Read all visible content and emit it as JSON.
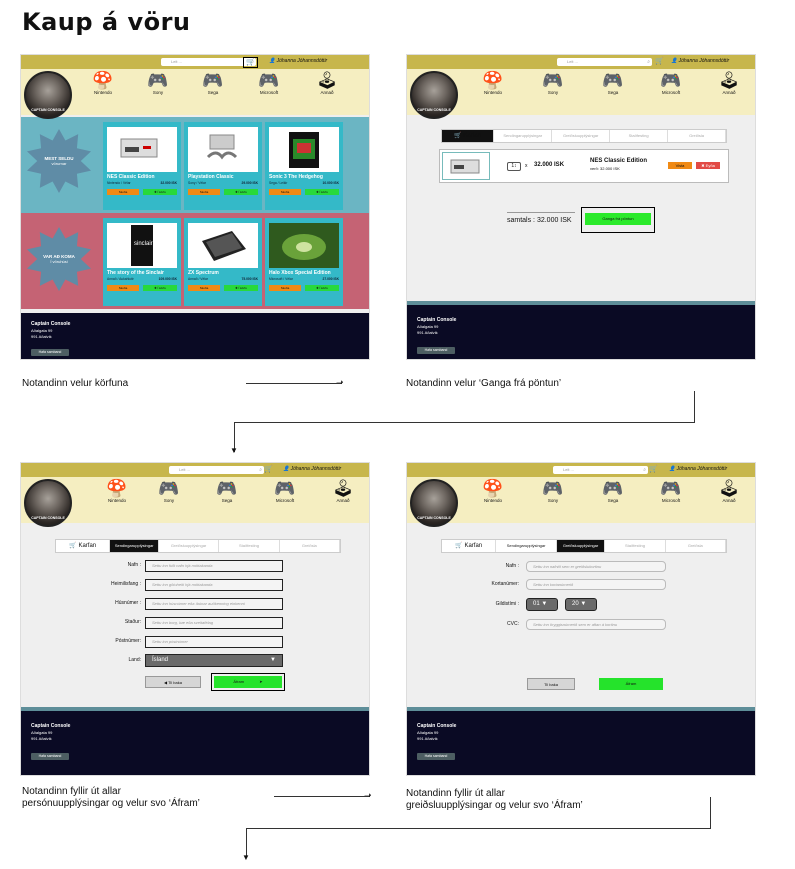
{
  "title": "Kaup á vöru",
  "common": {
    "search_placeholder": "Leit ...",
    "user_name": "Jóhanna Jóhannsdóttir",
    "logo_text": "CAPTAIN CONSOLE",
    "categories": [
      {
        "label": "Nintendo",
        "icon": "nintendo-icon"
      },
      {
        "label": "Sony",
        "icon": "gamepad-icon"
      },
      {
        "label": "Sega",
        "icon": "sega-pad-icon"
      },
      {
        "label": "Microsoft",
        "icon": "xbox-pad-icon"
      },
      {
        "label": "Annað",
        "icon": "joystick-icon"
      }
    ],
    "footer": {
      "name": "Captain Console",
      "addr1": "Aðalgata 99",
      "addr2": "991 Aðalvík",
      "button": "Hafa samband"
    }
  },
  "screen1": {
    "promo1": {
      "line1": "MEST SELDU",
      "line2": "vörurnar"
    },
    "promo2": {
      "line1": "VAR AÐ KOMA",
      "line2": "Í vöruhúsi"
    },
    "cards": [
      {
        "name": "NES Classic Edition",
        "sub": "Nintendo / Vélar",
        "price": "32.000 ISK"
      },
      {
        "name": "Playstation Classic",
        "sub": "Sony / Vélar",
        "price": "29.000 ISK"
      },
      {
        "name": "Sonic 3 The Hedgehog",
        "sub": "Sega / Leikir",
        "price": "10.000 ISK"
      },
      {
        "name": "The story of the Sinclair",
        "sub": "Annað / Aukahlutir",
        "price": "109.000 ISK"
      },
      {
        "name": "ZX Spectrum",
        "sub": "Annað / Vélar",
        "price": "75.000 ISK"
      },
      {
        "name": "Halo Xbox Special Edition",
        "sub": "Microsoft / Vélar",
        "price": "27.000 ISK"
      }
    ],
    "btn_more": "Skoða",
    "btn_add": "Í körfu"
  },
  "screen2": {
    "steps": [
      "Karfan",
      "Sendingarupplýsingar",
      "Greiðsluupplýsingar",
      "Staðfesting",
      "Greiðsla"
    ],
    "qty": "1",
    "times": "x",
    "price": "32.000 ISK",
    "item_name": "NES Classic Edition",
    "item_sub": "verð: 32.000 ISK",
    "btn_remove": "Eyða",
    "btn_save": "Vista",
    "total": "samtals : 32.000 ISK",
    "checkout": "Ganga frá pöntun"
  },
  "screen3": {
    "fields": [
      {
        "label": "Nafn :",
        "placeholder": "Settu inn fullt nafn hjá móttakanda"
      },
      {
        "label": "Heimilisfang :",
        "placeholder": "Settu inn götuheiti hjá móttakanda"
      },
      {
        "label": "Húsnúmer :",
        "placeholder": "Settu inn húsnúmer eða íbúnar auðkenning einkenni"
      },
      {
        "label": "Staður:",
        "placeholder": "Settu inn borg, bæ eða sveitafélag"
      },
      {
        "label": "Póstnúmer:",
        "placeholder": "Settu inn póstnúmer"
      }
    ],
    "country_label": "Land:",
    "country_value": "Ísland",
    "back": "Til baka",
    "next": "Áfram"
  },
  "screen4": {
    "fields": [
      {
        "label": "Nafn :",
        "placeholder": "Settu inn nafnið sem er greiðslukortinu"
      },
      {
        "label": "Kortanúmer:",
        "placeholder": "Settu inn kortanúmerið"
      }
    ],
    "expiry_label": "Gildistími :",
    "month": "01",
    "year": "20",
    "cvc_label": "CVC:",
    "cvc_placeholder": "Settu inn öryggisnúmerið sem er aftan á kortinu",
    "back": "Til baka",
    "next": "Áfram"
  },
  "captions": {
    "c1": "Notandinn velur körfuna",
    "c2": "Notandinn velur ‘Ganga frá pöntun’",
    "c3a": "Notandinn fyllir út allar",
    "c3b": "persónuupplýsingar og velur svo ‘Áfram’",
    "c4a": "Notandinn fyllir út allar",
    "c4b": "greiðsluupplýsingar og velur svo ‘Áfram’"
  }
}
